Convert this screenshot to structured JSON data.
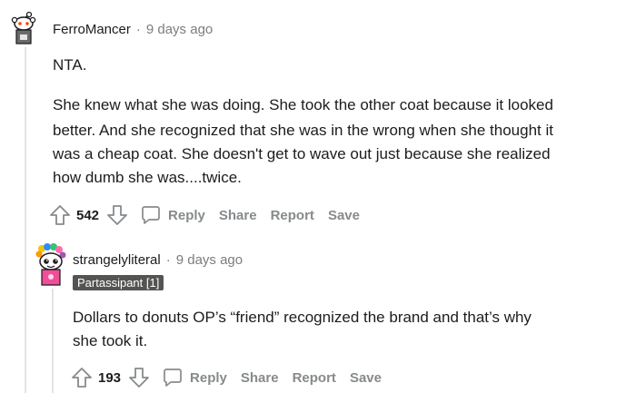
{
  "comments": [
    {
      "username": "FerroMancer",
      "separator": "·",
      "time": "9 days ago",
      "paragraphs": [
        [
          "NTA."
        ],
        [
          "She knew what she was doing. She took the other coat because it looked",
          "better. And she recognized that she was in the wrong when she thought it",
          "was a cheap coat. She doesn't get to wave out just because she realized",
          "how dumb she was....twice."
        ]
      ],
      "score": "542",
      "actions": {
        "reply": "Reply",
        "share": "Share",
        "report": "Report",
        "save": "Save"
      }
    },
    {
      "username": "strangelyliteral",
      "separator": "·",
      "time": "9 days ago",
      "flair": "Partassipant [1]",
      "paragraphs": [
        [
          "Dollars to donuts OP’s “friend” recognized the brand and that’s why",
          "she took it."
        ]
      ],
      "score": "193",
      "actions": {
        "reply": "Reply",
        "share": "Share",
        "report": "Report",
        "save": "Save"
      }
    }
  ],
  "icons": {
    "upvote": "arrow-up-icon",
    "downvote": "arrow-down-icon",
    "reply": "speech-bubble-icon"
  },
  "colors": {
    "text": "#1c1c1c",
    "muted": "#878a8c",
    "flair_bg": "#545452",
    "thread_line": "#e2e4e6"
  }
}
